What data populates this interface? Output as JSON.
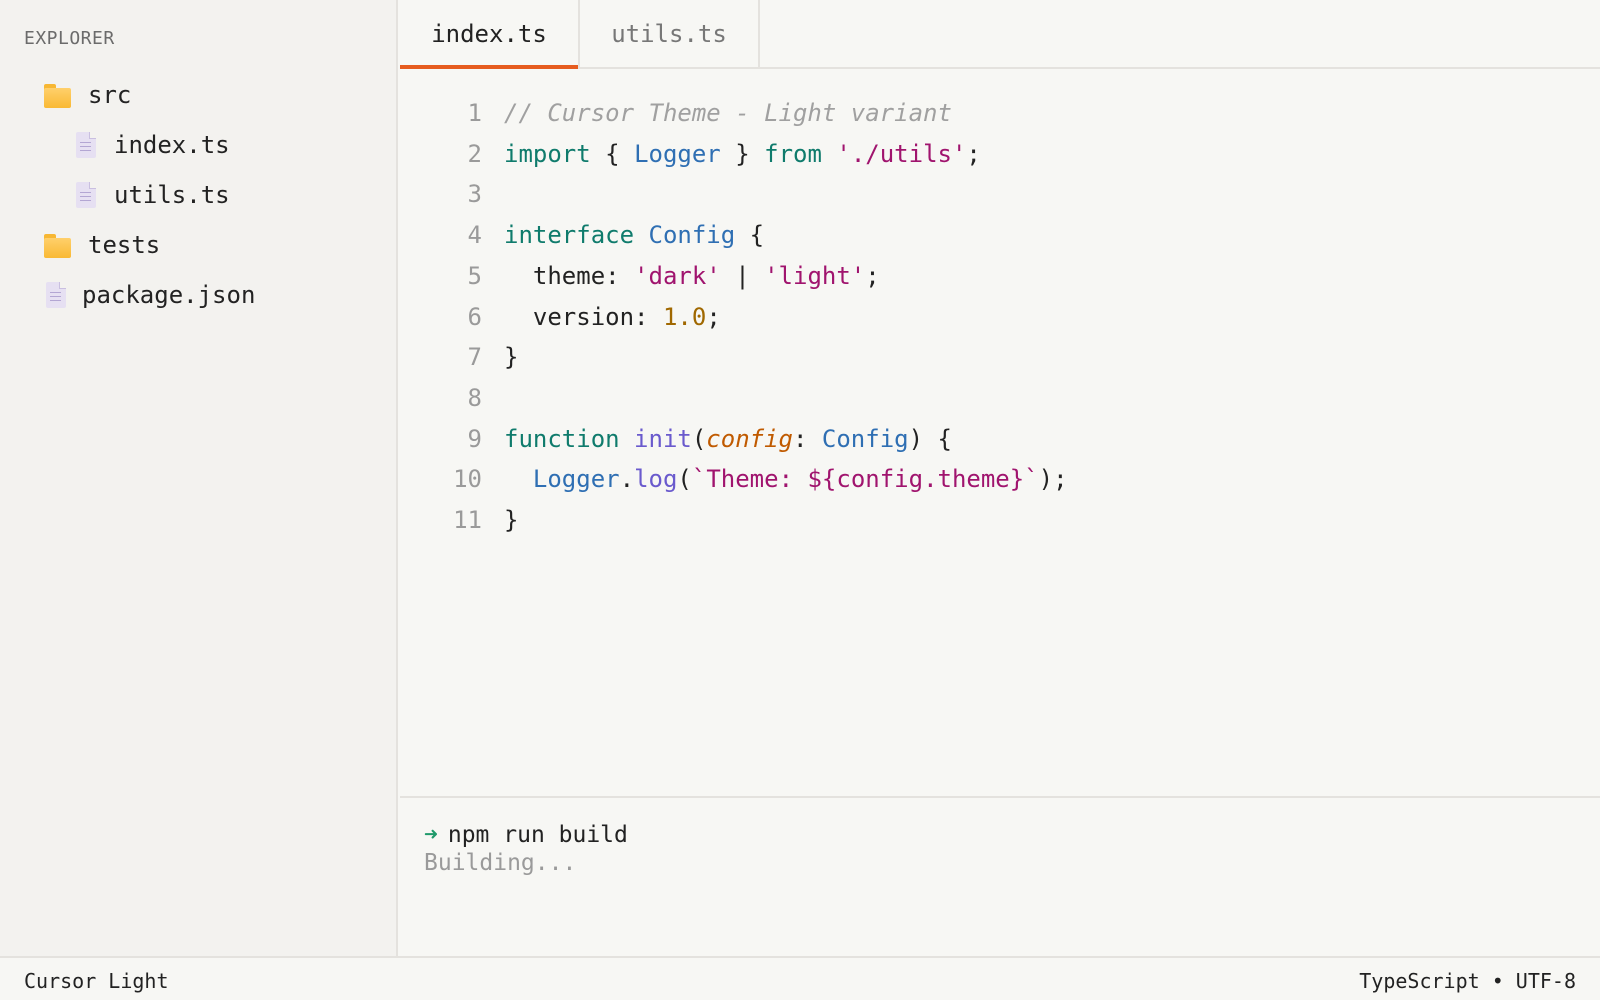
{
  "sidebar": {
    "title": "EXPLORER",
    "items": [
      {
        "label": "src",
        "type": "folder",
        "depth": 0
      },
      {
        "label": "index.ts",
        "type": "file",
        "depth": 1
      },
      {
        "label": "utils.ts",
        "type": "file",
        "depth": 1
      },
      {
        "label": "tests",
        "type": "folder",
        "depth": 0
      },
      {
        "label": "package.json",
        "type": "file",
        "depth": 0
      }
    ]
  },
  "tabs": [
    {
      "label": "index.ts",
      "active": true
    },
    {
      "label": "utils.ts",
      "active": false
    }
  ],
  "editor": {
    "lines": [
      {
        "num": "1",
        "tokens": [
          {
            "t": "// Cursor Theme - Light variant",
            "c": "cm"
          }
        ]
      },
      {
        "num": "2",
        "tokens": [
          {
            "t": "import",
            "c": "kw"
          },
          {
            "t": " { ",
            "c": "code"
          },
          {
            "t": "Logger",
            "c": "ty"
          },
          {
            "t": " } ",
            "c": "code"
          },
          {
            "t": "from",
            "c": "kw"
          },
          {
            "t": " ",
            "c": "code"
          },
          {
            "t": "'./utils'",
            "c": "st"
          },
          {
            "t": ";",
            "c": "code"
          }
        ]
      },
      {
        "num": "3",
        "tokens": []
      },
      {
        "num": "4",
        "tokens": [
          {
            "t": "interface",
            "c": "kw"
          },
          {
            "t": " ",
            "c": "code"
          },
          {
            "t": "Config",
            "c": "ty"
          },
          {
            "t": " {",
            "c": "code"
          }
        ]
      },
      {
        "num": "5",
        "tokens": [
          {
            "t": "  theme: ",
            "c": "code"
          },
          {
            "t": "'dark'",
            "c": "st"
          },
          {
            "t": " | ",
            "c": "code"
          },
          {
            "t": "'light'",
            "c": "st"
          },
          {
            "t": ";",
            "c": "code"
          }
        ]
      },
      {
        "num": "6",
        "tokens": [
          {
            "t": "  version: ",
            "c": "code"
          },
          {
            "t": "1.0",
            "c": "nu"
          },
          {
            "t": ";",
            "c": "code"
          }
        ]
      },
      {
        "num": "7",
        "tokens": [
          {
            "t": "}",
            "c": "code"
          }
        ]
      },
      {
        "num": "8",
        "tokens": []
      },
      {
        "num": "9",
        "tokens": [
          {
            "t": "function",
            "c": "kw"
          },
          {
            "t": " ",
            "c": "code"
          },
          {
            "t": "init",
            "c": "fn"
          },
          {
            "t": "(",
            "c": "code"
          },
          {
            "t": "config",
            "c": "pa"
          },
          {
            "t": ": ",
            "c": "code"
          },
          {
            "t": "Config",
            "c": "ty"
          },
          {
            "t": ") {",
            "c": "code"
          }
        ]
      },
      {
        "num": "10",
        "tokens": [
          {
            "t": "  ",
            "c": "code"
          },
          {
            "t": "Logger",
            "c": "ty"
          },
          {
            "t": ".",
            "c": "code"
          },
          {
            "t": "log",
            "c": "fn"
          },
          {
            "t": "(",
            "c": "code"
          },
          {
            "t": "`Theme: ${config.theme}`",
            "c": "st"
          },
          {
            "t": ");",
            "c": "code"
          }
        ]
      },
      {
        "num": "11",
        "tokens": [
          {
            "t": "}",
            "c": "code"
          }
        ]
      }
    ]
  },
  "terminal": {
    "prompt_symbol": "➜",
    "command": "npm run build",
    "output": "Building..."
  },
  "statusbar": {
    "left": "Cursor Light",
    "right": "TypeScript • UTF-8"
  },
  "colors": {
    "accent": "#e65c1f",
    "keyword": "#0f7b6c",
    "type": "#2f6fb3",
    "string": "#a0146e",
    "number": "#a06800",
    "function": "#6a5acd",
    "comment": "#a0a0a0"
  }
}
